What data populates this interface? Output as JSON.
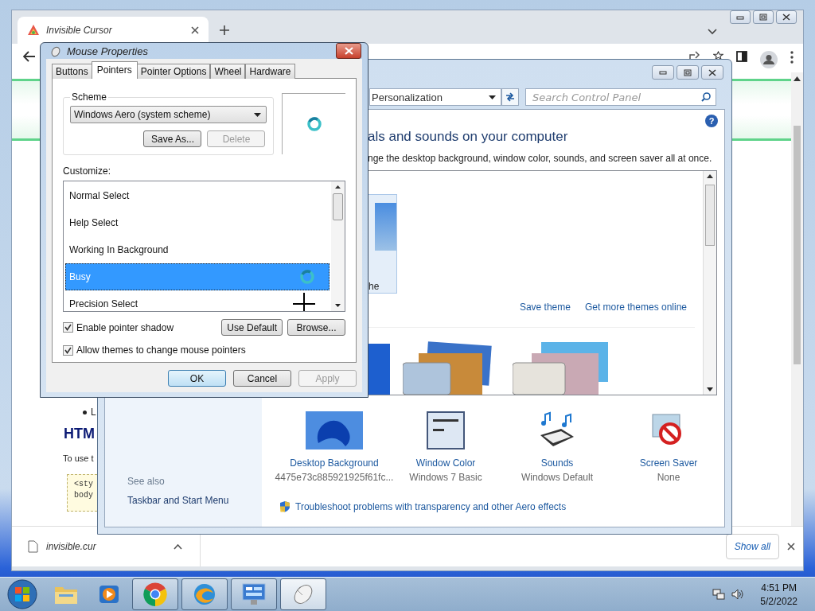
{
  "browser": {
    "tab": {
      "title": "Invisible Cursor",
      "selected": true
    },
    "page": {
      "bullets": [
        "L"
      ],
      "heading": "HTM",
      "paragraph": "To use t",
      "code_lines": [
        "<sty",
        "body"
      ]
    },
    "download": {
      "file": "invisible.cur",
      "show_all": "Show all"
    }
  },
  "control_panel": {
    "address": "Personalization",
    "search": {
      "placeholder": "Search Control Panel"
    },
    "heading": "als and sounds on your computer",
    "description": "nge the desktop background, window color, sounds, and screen saver all at once.",
    "theme_label": "he",
    "links": [
      "Save theme",
      "Get more themes online"
    ],
    "items": [
      {
        "kind": "background",
        "label": "Desktop Background",
        "value": "4475e73c885921925f61fc..."
      },
      {
        "kind": "window",
        "label": "Window Color",
        "value": "Windows 7 Basic"
      },
      {
        "kind": "sounds",
        "label": "Sounds",
        "value": "Windows Default"
      },
      {
        "kind": "saver",
        "label": "Screen Saver",
        "value": "None"
      }
    ],
    "troubleshoot": "Troubleshoot problems with transparency and other Aero effects",
    "see_also": {
      "title": "See also",
      "links": [
        "Taskbar and Start Menu"
      ]
    },
    "help": "?"
  },
  "mouse_properties": {
    "title": "Mouse Properties",
    "tabs": [
      {
        "label": "Buttons",
        "selected": false
      },
      {
        "label": "Pointers",
        "selected": true
      },
      {
        "label": "Pointer Options",
        "selected": false
      },
      {
        "label": "Wheel",
        "selected": false
      },
      {
        "label": "Hardware",
        "selected": false
      }
    ],
    "scheme_label": "Scheme",
    "scheme": "Windows Aero (system scheme)",
    "scheme_buttons": [
      {
        "label": "Save As...",
        "disabled": false
      },
      {
        "label": "Delete",
        "disabled": true
      }
    ],
    "customize_label": "Customize:",
    "pointers": [
      {
        "name": "Normal Select",
        "kind": "none",
        "selected": false
      },
      {
        "name": "Help Select",
        "kind": "none",
        "selected": false
      },
      {
        "name": "Working In Background",
        "kind": "none",
        "selected": false
      },
      {
        "name": "Busy",
        "kind": "busy",
        "selected": true
      },
      {
        "name": "Precision Select",
        "kind": "cross",
        "selected": false
      }
    ],
    "checkboxes": [
      {
        "label": "Enable pointer shadow",
        "checked": true
      },
      {
        "label": "Allow themes to change mouse pointers",
        "checked": true
      }
    ],
    "list_buttons": [
      "Use Default",
      "Browse..."
    ],
    "buttons": [
      {
        "label": "OK",
        "default": true,
        "disabled": false
      },
      {
        "label": "Cancel",
        "default": false,
        "disabled": false
      },
      {
        "label": "Apply",
        "default": false,
        "disabled": true
      }
    ]
  },
  "taskbar": {
    "apps": [
      {
        "kind": "folder",
        "running": false,
        "active": false
      },
      {
        "kind": "media",
        "running": false,
        "active": false
      },
      {
        "kind": "chrome",
        "running": true,
        "active": false
      },
      {
        "kind": "swirl",
        "running": true,
        "active": false
      },
      {
        "kind": "panel",
        "running": true,
        "active": false
      },
      {
        "kind": "mouse",
        "running": true,
        "active": true
      }
    ],
    "time": "4:51 PM",
    "date": "5/2/2022"
  }
}
